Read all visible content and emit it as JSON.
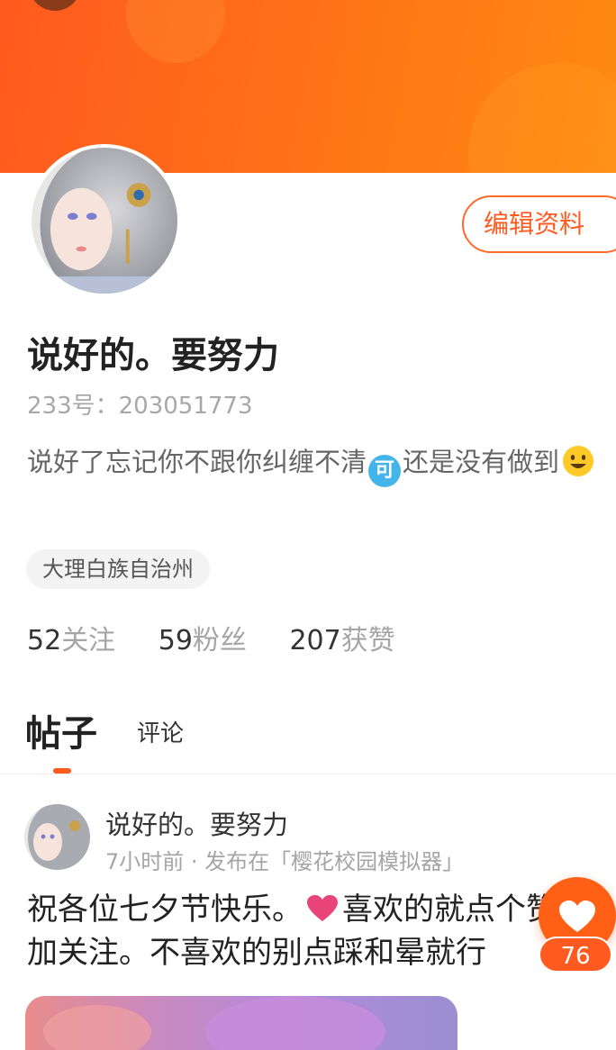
{
  "profile": {
    "edit_button": "编辑资料",
    "username": "说好的。要努力",
    "uid": "233号：203051773",
    "bio_part1": "说好了忘记你不跟你纠缠不清",
    "bio_emoji": "可",
    "bio_part2": "还是没有做到",
    "location": "大理白族自治州",
    "stats": [
      {
        "num": "52",
        "label": "关注"
      },
      {
        "num": "59",
        "label": "粉丝"
      },
      {
        "num": "207",
        "label": "获赞"
      }
    ]
  },
  "tabs": {
    "posts": "帖子",
    "comments": "评论",
    "active": "posts"
  },
  "post": {
    "author": "说好的。要努力",
    "meta": "7小时前 · 发布在「樱花校园模拟器」",
    "text_part1": "祝各位七夕节快乐。",
    "text_part2": "喜欢的就点个赞",
    "text_part3": "加关注。不喜欢的别点踩和晕就行",
    "like_count": "76"
  },
  "colors": {
    "accent": "#ff5a1f",
    "banner": "#ff7416",
    "emoji_blue": "#43b5ea",
    "heart_pink": "#e8447a"
  }
}
